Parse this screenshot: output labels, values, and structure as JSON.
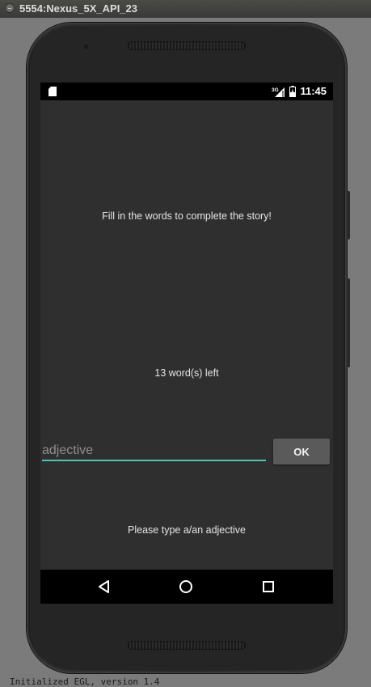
{
  "window": {
    "title": "5554:Nexus_5X_API_23"
  },
  "status_bar": {
    "network": "3G",
    "time": "11:45"
  },
  "screen": {
    "instruction": "Fill in the words to complete the story!",
    "words_left": "13 word(s) left",
    "input": {
      "value": "",
      "placeholder": "adjective"
    },
    "ok_label": "OK",
    "prompt": "Please type a/an adjective"
  },
  "console": {
    "text": "Initialized EGL, version 1.4"
  },
  "colors": {
    "screen_background": "#2f2f2f",
    "input_underline": "#4fc3b5",
    "button_background": "#5a5a5a"
  },
  "icons": {
    "status_left": "sd-card-icon",
    "signal": "cell-signal-icon",
    "battery": "battery-charging-icon",
    "nav_back": "back-triangle-icon",
    "nav_home": "home-circle-icon",
    "nav_recents": "recents-square-icon"
  }
}
